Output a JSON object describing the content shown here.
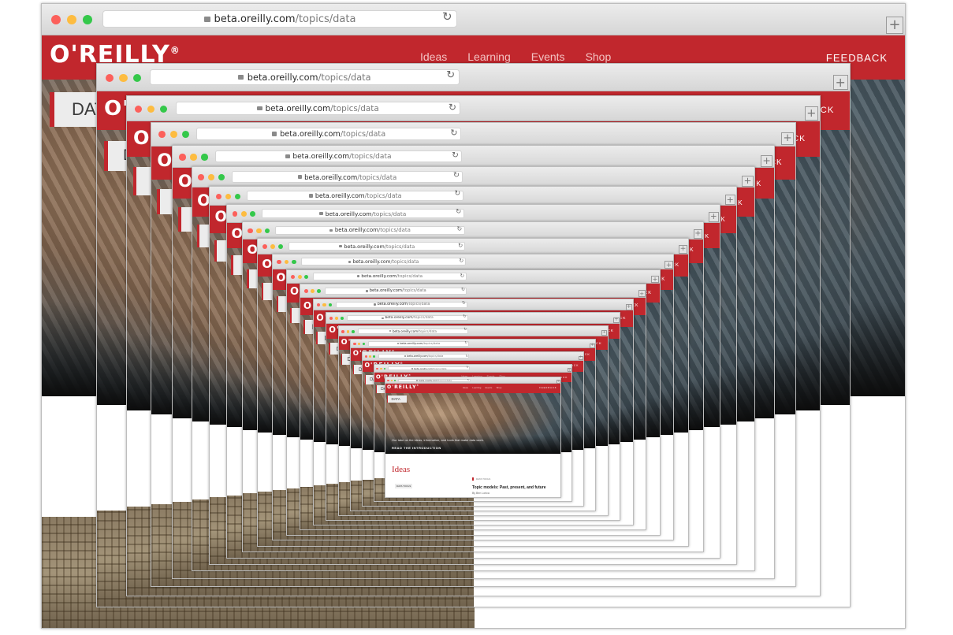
{
  "browser": {
    "url_host": "beta.oreilly.com",
    "url_path": "/topics/data",
    "new_tab_label": "+",
    "reload_icon": "reload-icon",
    "lock_icon": "lock-icon",
    "traffic_lights": [
      "#fc605b",
      "#fdbc40",
      "#34c84a"
    ]
  },
  "site": {
    "logo_text": "O'REILLY",
    "logo_mark": "®",
    "nav_links": [
      "Ideas",
      "Learning",
      "Events",
      "Shop"
    ],
    "feedback_label": "FEEDBACK",
    "topic_label": "DATA",
    "brand_color": "#c1272d"
  },
  "innermost": {
    "tagline": "Our take on the ideas, information, and tools that make data work.",
    "cta": "READ THE INTRODUCTION",
    "section_heading": "Ideas",
    "article_tag": "DATA TOOLS",
    "article_title": "Topic models: Past, present, and future",
    "article_byline": "By Ben Lorica",
    "data_tag": "DATA TOOLS"
  },
  "recursion_depth": 20
}
